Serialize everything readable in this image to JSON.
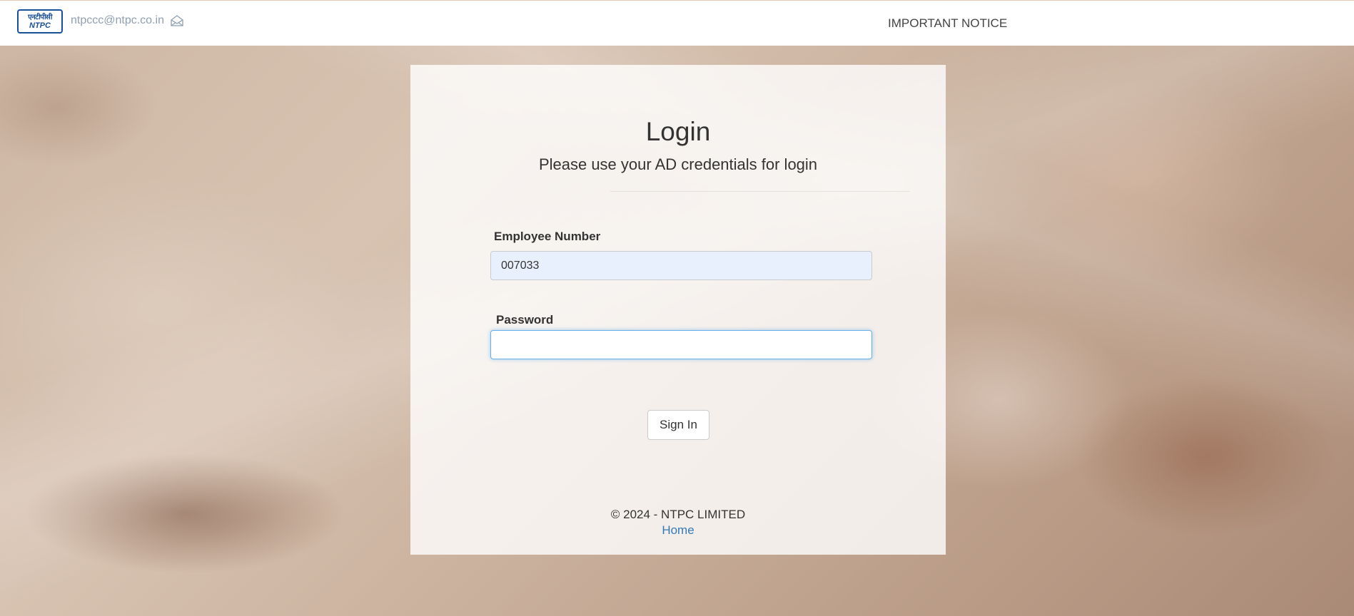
{
  "header": {
    "logo_text_top": "एनटीपीसी",
    "logo_text_bottom": "NTPC",
    "email": "ntpccc@ntpc.co.in",
    "notice_link": "IMPORTANT NOTICE"
  },
  "login": {
    "title": "Login",
    "subtitle": "Please use your AD credentials for login",
    "employee_label": "Employee Number",
    "employee_value": "007033",
    "password_label": "Password",
    "password_value": "",
    "signin_button": "Sign In"
  },
  "footer": {
    "copyright": "© 2024 - NTPC LIMITED",
    "home_link": "Home"
  },
  "colors": {
    "brand_blue": "#1b4f9c",
    "link_blue": "#337ab7",
    "autofill_bg": "#e8f0fe",
    "focus_border": "#66afe9"
  },
  "icons": {
    "logo": "ntpc-logo",
    "email": "envelope-open-icon"
  }
}
